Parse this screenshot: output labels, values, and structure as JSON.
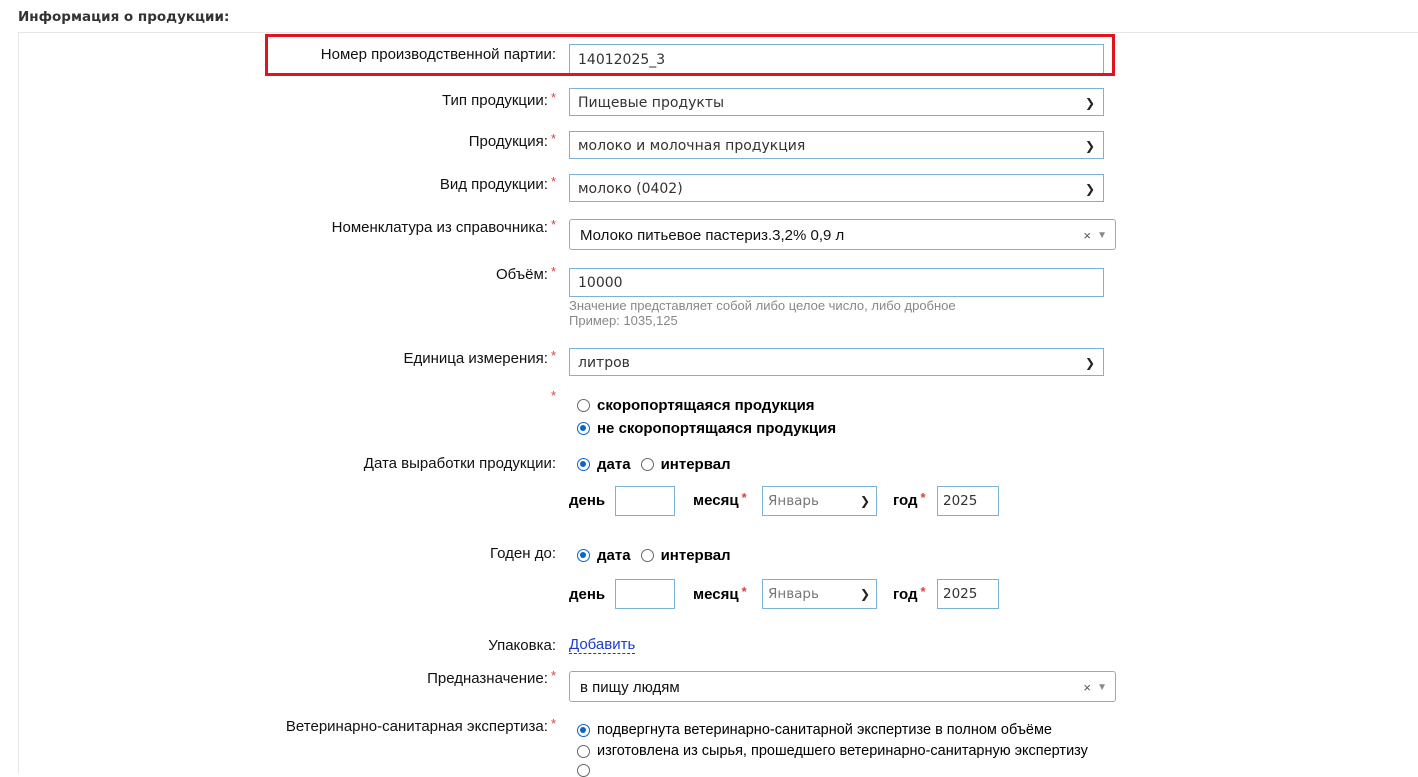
{
  "section": {
    "title": "Информация о продукции:"
  },
  "required_mark": "*",
  "batch": {
    "label": "Номер производственной партии:",
    "value": "14012025_3"
  },
  "product_type": {
    "label": "Тип продукции:",
    "value": "Пищевые продукты"
  },
  "product": {
    "label": "Продукция:",
    "value": "молоко и молочная продукция"
  },
  "product_kind": {
    "label": "Вид продукции:",
    "value": "молоко (0402)"
  },
  "nomenclature": {
    "label": "Номенклатура из справочника:",
    "value": "Молоко питьевое пастериз.3,2% 0,9 л",
    "clear": "×",
    "arrow": "▼"
  },
  "volume": {
    "label": "Объём:",
    "value": "10000",
    "hint1": "Значение представляет собой либо целое число, либо дробное",
    "hint2": "Пример: 1035,125"
  },
  "unit": {
    "label": "Единица измерения:",
    "value": "литров"
  },
  "perishable": {
    "options": [
      {
        "label": "скоропортящаяся продукция",
        "checked": false
      },
      {
        "label": "не скоропортящаяся продукция",
        "checked": true
      }
    ]
  },
  "production_date": {
    "label": "Дата выработки продукции:",
    "mode_options": [
      "дата",
      "интервал"
    ],
    "day_label": "день",
    "day_value": "",
    "month_label": "месяц",
    "month_value": "Январь",
    "year_label": "год",
    "year_value": "2025"
  },
  "expiry_date": {
    "label": "Годен до:",
    "mode_options": [
      "дата",
      "интервал"
    ],
    "day_label": "день",
    "day_value": "",
    "month_label": "месяц",
    "month_value": "Январь",
    "year_label": "год",
    "year_value": "2025"
  },
  "packaging": {
    "label": "Упаковка:",
    "link": "Добавить"
  },
  "purpose": {
    "label": "Предназначение:",
    "value": "в пищу людям",
    "clear": "×",
    "arrow": "▼"
  },
  "vet_expertise": {
    "label": "Ветеринарно-санитарная экспертиза:",
    "options": [
      {
        "label": "подвергнута ветеринарно-санитарной экспертизе в полном объёме",
        "checked": true
      },
      {
        "label": "изготовлена из сырья, прошедшего ветеринарно-санитарную экспертизу",
        "checked": false
      }
    ]
  },
  "colors": {
    "accent": "#0b63ce",
    "border": "#7bb3d6",
    "required": "#e23c3c",
    "highlight": "#e0141e",
    "link": "#1a3bd1"
  }
}
